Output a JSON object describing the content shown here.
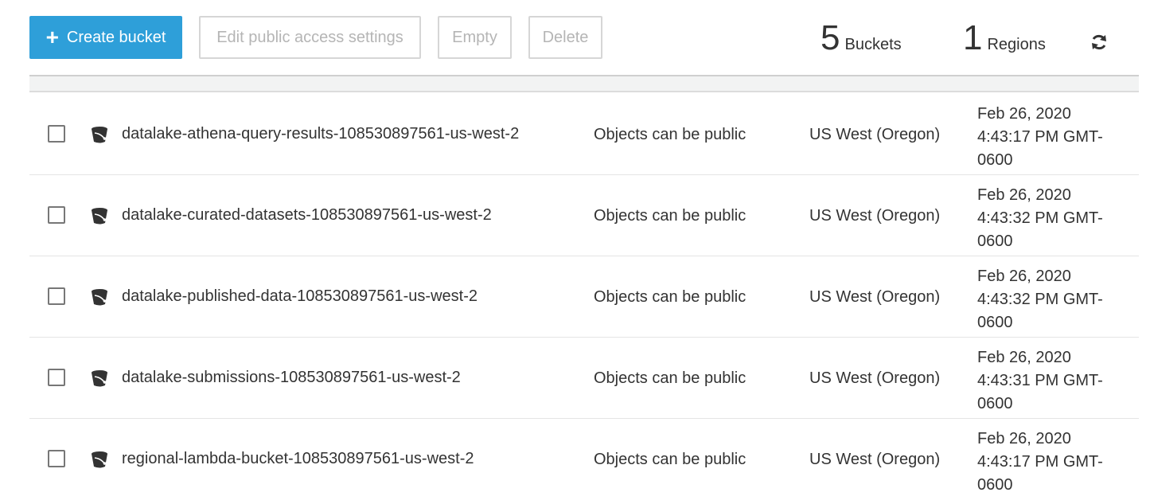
{
  "toolbar": {
    "create_plus": "+",
    "create_label": "Create bucket",
    "edit_label": "Edit public access settings",
    "empty_label": "Empty",
    "delete_label": "Delete"
  },
  "summary": {
    "buckets_count": "5",
    "buckets_label": "Buckets",
    "regions_count": "1",
    "regions_label": "Regions"
  },
  "icons": {
    "refresh": "refresh-icon",
    "bucket": "bucket-icon"
  },
  "colors": {
    "primary": "#2e9fd9",
    "disabled_text": "#b5b5b5"
  },
  "buckets": [
    {
      "name": "datalake-athena-query-results-108530897561-us-west-2",
      "access": "Objects can be public",
      "region": "US West (Oregon)",
      "date_line1": "Feb 26, 2020",
      "date_line2": "4:43:17 PM GMT-",
      "date_line3": "0600"
    },
    {
      "name": "datalake-curated-datasets-108530897561-us-west-2",
      "access": "Objects can be public",
      "region": "US West (Oregon)",
      "date_line1": "Feb 26, 2020",
      "date_line2": "4:43:32 PM GMT-",
      "date_line3": "0600"
    },
    {
      "name": "datalake-published-data-108530897561-us-west-2",
      "access": "Objects can be public",
      "region": "US West (Oregon)",
      "date_line1": "Feb 26, 2020",
      "date_line2": "4:43:32 PM GMT-",
      "date_line3": "0600"
    },
    {
      "name": "datalake-submissions-108530897561-us-west-2",
      "access": "Objects can be public",
      "region": "US West (Oregon)",
      "date_line1": "Feb 26, 2020",
      "date_line2": "4:43:31 PM GMT-",
      "date_line3": "0600"
    },
    {
      "name": "regional-lambda-bucket-108530897561-us-west-2",
      "access": "Objects can be public",
      "region": "US West (Oregon)",
      "date_line1": "Feb 26, 2020",
      "date_line2": "4:43:17 PM GMT-",
      "date_line3": "0600"
    }
  ]
}
